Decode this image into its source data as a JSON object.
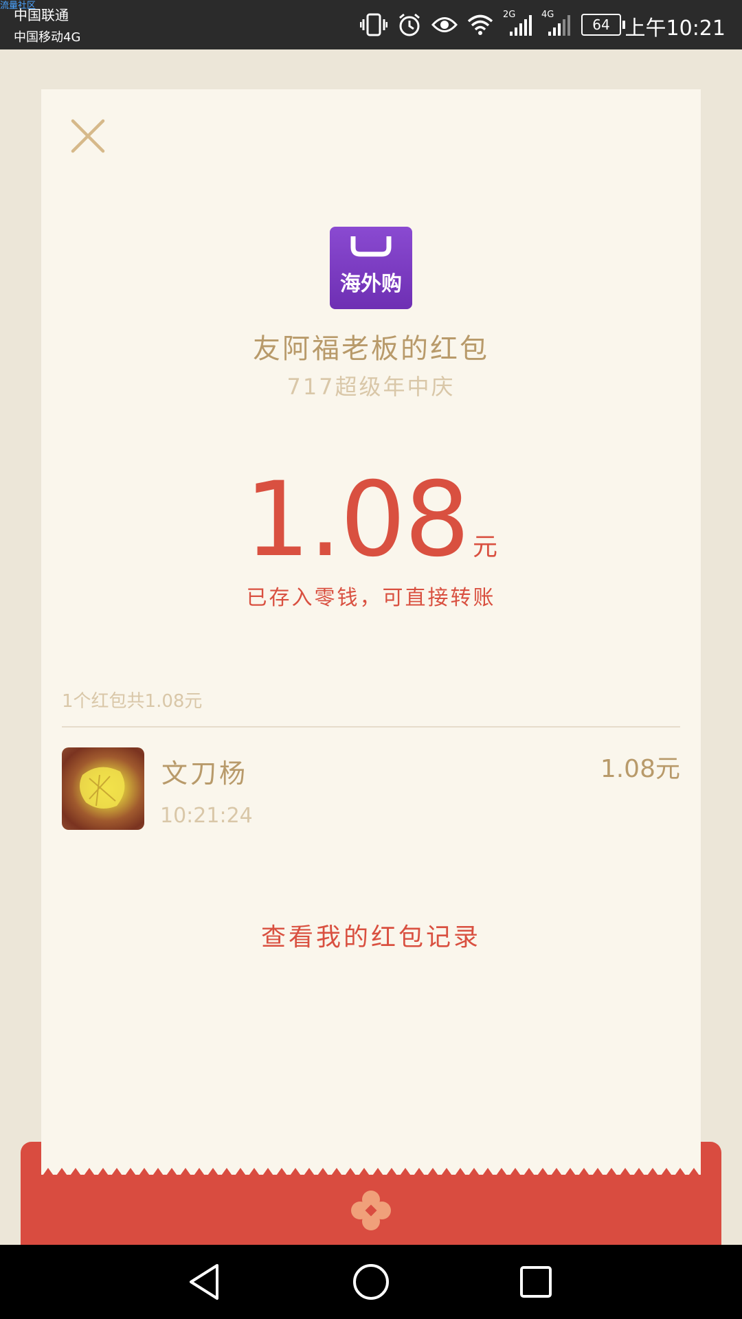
{
  "status_bar": {
    "watermark": "流量社区",
    "carrier_1": "中国联通",
    "carrier_2": "中国移动4G",
    "network_1": "2G",
    "network_2": "4G",
    "battery": "64",
    "time": "上午10:21",
    "icons": [
      "vibrate-icon",
      "alarm-icon",
      "eye-icon",
      "wifi-icon",
      "signal-icon",
      "signal-icon",
      "battery-icon"
    ]
  },
  "red_packet": {
    "app_logo_text": "海外购",
    "sender_title": "友阿福老板的红包",
    "subtitle": "717超级年中庆",
    "amount": "1.08",
    "unit": "元",
    "notice": "已存入零钱，可直接转账",
    "summary": "1个红包共1.08元"
  },
  "receivers": [
    {
      "name": "文刀杨",
      "time": "10:21:24",
      "amount": "1.08元"
    }
  ],
  "history_link": "查看我的红包记录",
  "colors": {
    "accent_red": "#d95040",
    "gold_text": "#b89a6a",
    "muted_text": "#d9c7a8",
    "card_bg": "#faf6ec",
    "page_bg": "#ece6d8"
  }
}
